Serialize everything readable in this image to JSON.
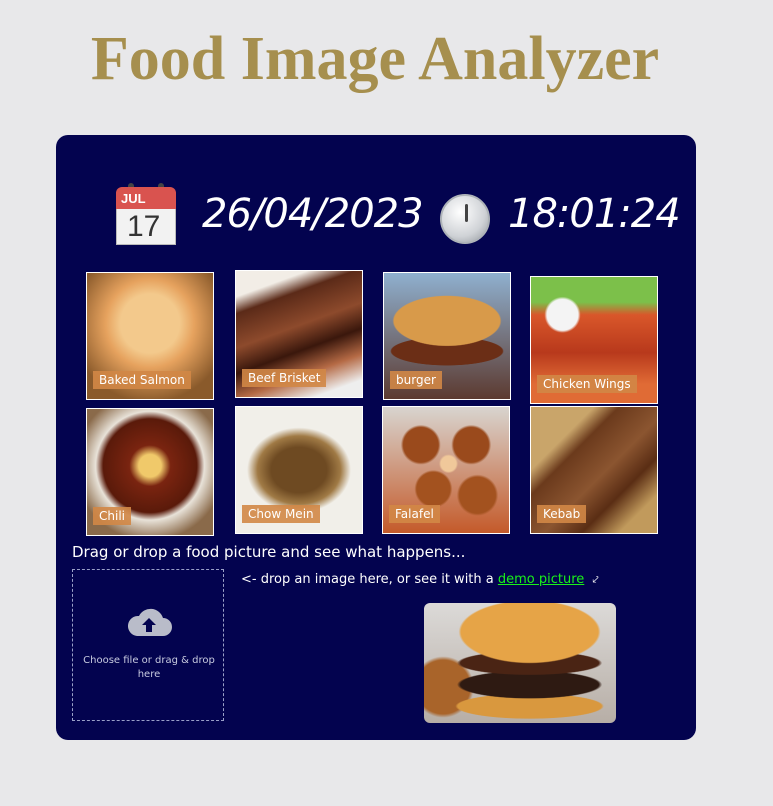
{
  "app": {
    "title": "Food Image Analyzer"
  },
  "datetime": {
    "calendar_month": "JUL",
    "calendar_day": "17",
    "date": "26/04/2023",
    "time": "18:01:24",
    "calendar_icon": "calendar-icon",
    "clock_icon": "clock-icon"
  },
  "gallery": {
    "items": [
      {
        "label": "Baked Salmon"
      },
      {
        "label": "Beef Brisket"
      },
      {
        "label": "burger"
      },
      {
        "label": "Chicken Wings"
      },
      {
        "label": "Chili"
      },
      {
        "label": "Chow Mein"
      },
      {
        "label": "Falafel"
      },
      {
        "label": "Kebab"
      }
    ]
  },
  "upload": {
    "instruction": "Drag or drop a food picture and see what happens...",
    "dropzone_text": "Choose file or drag & drop here",
    "upload_icon": "cloud-upload-icon",
    "hint_prefix": "<- drop an image here, or see it with a",
    "demo_link": "demo picture",
    "hint_arrow": "⤦"
  },
  "colors": {
    "background": "#e8e8ea",
    "panel": "#03034f",
    "title": "#a68f4e",
    "label_badge": "#d28746",
    "link": "#19f219"
  }
}
